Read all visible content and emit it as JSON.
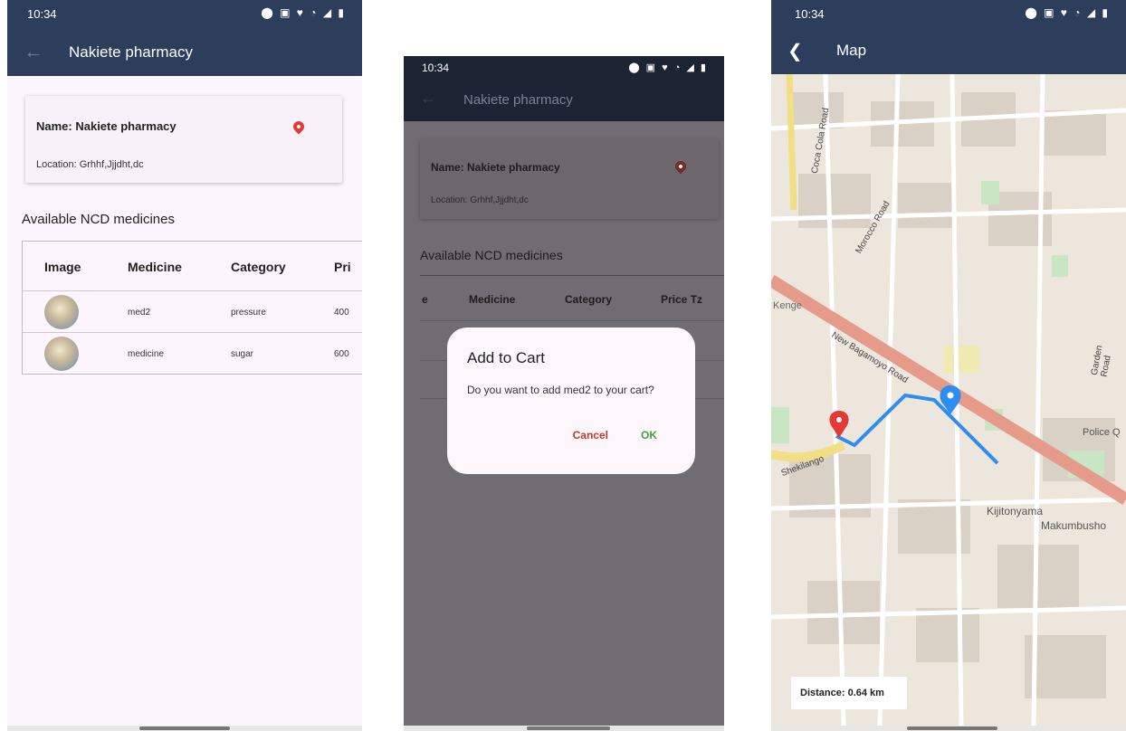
{
  "colors": {
    "appbar": "#2c3e5c",
    "accent_pin": "#e53935",
    "ok": "#43a047",
    "cancel": "#c0392b",
    "page_bg": "#fdf5fd",
    "overlay": "#6f6c73"
  },
  "status": {
    "time": "10:34",
    "icons": "⬤ ▣  ♥ ◔ ◢ ▮"
  },
  "pharmacy_screen": {
    "back_icon": "←",
    "title": "Nakiete pharmacy",
    "card": {
      "name": "Name: Nakiete pharmacy",
      "location": "Location: Grhhf,Jjjdht,dc",
      "pin_icon": "location-pin-icon"
    },
    "section_title": "Available NCD medicines",
    "table": {
      "headers": [
        "Image",
        "Medicine",
        "Category",
        "Pri"
      ],
      "rows": [
        {
          "medicine": "med2",
          "category": "pressure",
          "price": "400"
        },
        {
          "medicine": "medicine",
          "category": "sugar",
          "price": "600"
        }
      ]
    }
  },
  "dialog_screen": {
    "back_icon": "←",
    "title": "Nakiete pharmacy",
    "card": {
      "name": "Name: Nakiete pharmacy",
      "location": "Location: Grhhf,Jjjdht,dc"
    },
    "section_title": "Available NCD medicines",
    "headers": [
      "e",
      "Medicine",
      "Category",
      "Price Tz"
    ],
    "dialog": {
      "title": "Add to Cart",
      "message": "Do you want to add med2 to your cart?",
      "cancel": "Cancel",
      "ok": "OK"
    }
  },
  "map_screen": {
    "back_icon": "❮",
    "title": "Map",
    "distance": "Distance: 0.64 km",
    "labels": [
      "Coca Cola Road",
      "Morocco Road",
      "New Bagamoyo Road",
      "Kijitonyama",
      "Makumbusho",
      "Police Q",
      "Shekilango",
      "Kenge",
      "Garden Road"
    ]
  }
}
